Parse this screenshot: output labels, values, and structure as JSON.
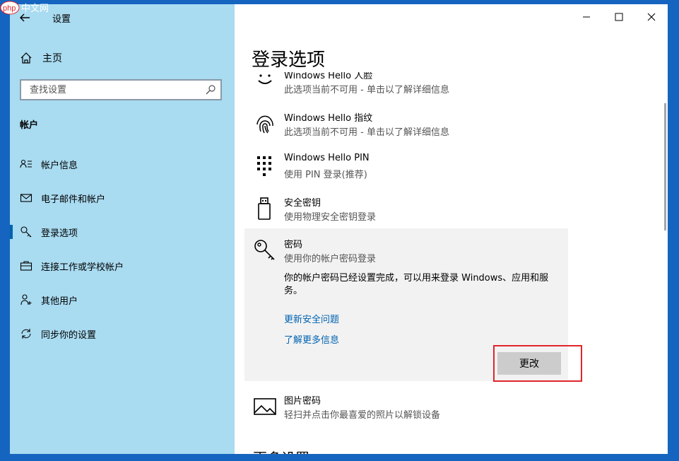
{
  "window": {
    "title": "设置",
    "controls": {
      "minimize": "minimize-icon",
      "maximize": "maximize-icon",
      "close": "close-icon"
    }
  },
  "watermark": {
    "text": "php中文网"
  },
  "sidebar": {
    "home_label": "主页",
    "search_placeholder": "查找设置",
    "section_title": "帐户",
    "items": [
      {
        "label": "帐户信息",
        "icon": "account-info-icon"
      },
      {
        "label": "电子邮件和帐户",
        "icon": "mail-icon"
      },
      {
        "label": "登录选项",
        "icon": "key-icon",
        "active": true
      },
      {
        "label": "连接工作或学校帐户",
        "icon": "briefcase-icon"
      },
      {
        "label": "其他用户",
        "icon": "add-user-icon"
      },
      {
        "label": "同步你的设置",
        "icon": "sync-icon"
      }
    ]
  },
  "main": {
    "title": "登录选项",
    "options": [
      {
        "title": "Windows Hello 人脸",
        "subtitle": "此选项当前不可用 - 单击以了解详细信息",
        "icon": "face-icon"
      },
      {
        "title": "Windows Hello 指纹",
        "subtitle": "此选项当前不可用 - 单击以了解详细信息",
        "icon": "fingerprint-icon"
      },
      {
        "title": "Windows Hello PIN",
        "subtitle": "使用 PIN 登录(推荐)",
        "icon": "pin-keypad-icon"
      },
      {
        "title": "安全密钥",
        "subtitle": "使用物理安全密钥登录",
        "icon": "usb-key-icon"
      },
      {
        "title": "密码",
        "subtitle": "使用你的帐户密码登录",
        "icon": "password-key-icon",
        "description": "你的帐户密码已经设置完成，可以用来登录 Windows、应用和服务。",
        "link1": "更新安全问题",
        "link2": "了解更多信息",
        "button": "更改"
      },
      {
        "title": "图片密码",
        "subtitle": "轻扫并点击你最喜爱的照片以解锁设备",
        "icon": "picture-icon"
      }
    ],
    "more_title": "更多设置"
  },
  "colors": {
    "sidebar_bg": "#a9dbf1",
    "accent": "#0063b1",
    "highlight": "#e0252b"
  }
}
